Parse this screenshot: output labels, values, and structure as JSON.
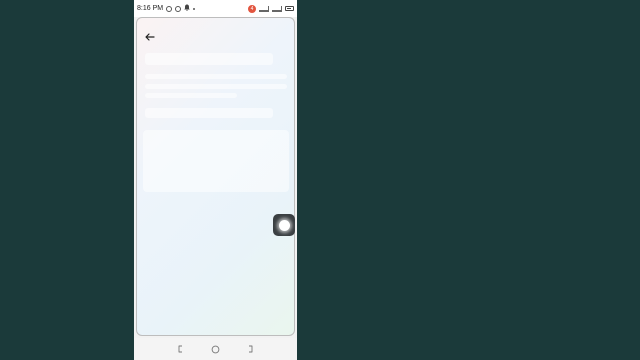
{
  "status_bar": {
    "time": "8:16 PM",
    "notification_count": "4",
    "icons": [
      "location-icon",
      "circle-icon",
      "bell-icon",
      "dot-icon",
      "signal-icon",
      "battery-icon"
    ]
  },
  "screen": {
    "back_icon": "arrow-left-icon",
    "loading_placeholders": true
  },
  "floating_button": {
    "icon": "assistive-touch-icon"
  },
  "nav_bar": {
    "icons": [
      "back-nav-icon",
      "home-nav-icon",
      "recents-nav-icon"
    ]
  },
  "colors": {
    "desktop_background": "#1b3a3a",
    "notification_badge": "#e2553f",
    "screen_gradient_start": "#fbf3f3",
    "screen_gradient_end": "#eaf6ee"
  }
}
